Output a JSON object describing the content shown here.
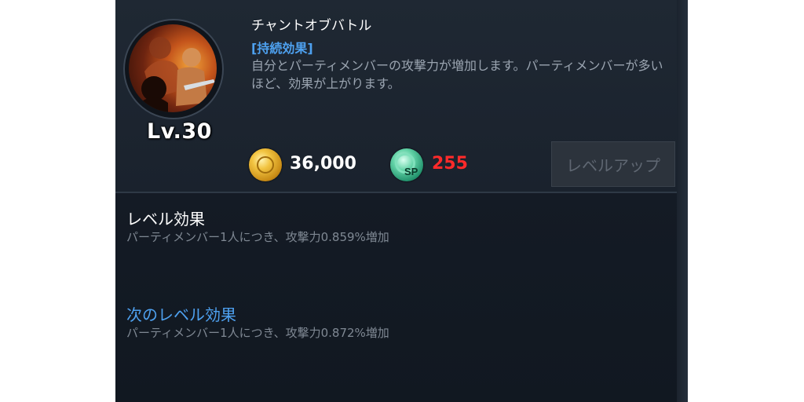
{
  "skill": {
    "name": "チャントオブバトル",
    "level": "Lv.30",
    "effect_header": "[持続効果]",
    "description": "自分とパーティメンバーの攻撃力が増加します。パーティメンバーが多いほど、効果が上がります。"
  },
  "cost": {
    "gold_icon": "gold-coin-icon",
    "gold": "36,000",
    "sp_icon": "sp-coin-icon",
    "sp_icon_label": "SP",
    "sp": "255",
    "sp_color": "#ff2a2a"
  },
  "buttons": {
    "level_up": "レベルアップ"
  },
  "level_effect": {
    "title": "レベル効果",
    "text": "パーティメンバー1人につき、攻撃力0.859%増加"
  },
  "next_level_effect": {
    "title": "次のレベル効果",
    "text": "パーティメンバー1人につき、攻撃力0.872%増加"
  },
  "colors": {
    "accent_blue": "#4ea1f0",
    "panel_bg": "#1b232e"
  }
}
